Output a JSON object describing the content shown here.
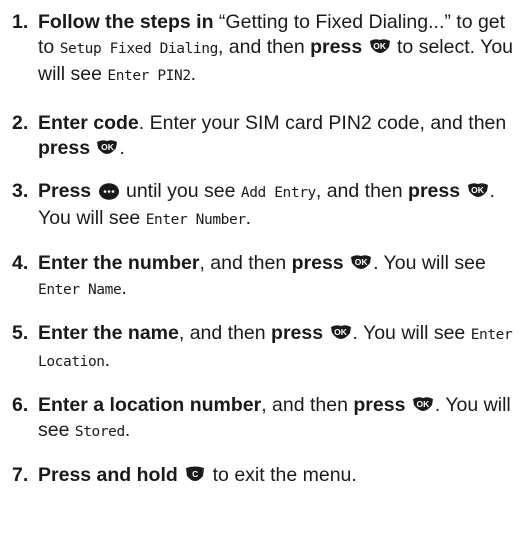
{
  "steps": [
    {
      "number": "1.",
      "parts": [
        {
          "t": "b",
          "v": "Follow the steps in"
        },
        {
          "t": "n",
          "v": " “Getting to Fixed Dialing...” to get to "
        },
        {
          "t": "lcd",
          "v": "Setup Fixed Dialing"
        },
        {
          "t": "n",
          "v": ", and then "
        },
        {
          "t": "b",
          "v": "press"
        },
        {
          "t": "n",
          "v": " "
        },
        {
          "t": "key",
          "v": "OK",
          "icon": "ok-key-icon"
        },
        {
          "t": "n",
          "v": " to select. You will see "
        },
        {
          "t": "lcd",
          "v": "Enter PIN2"
        },
        {
          "t": "n",
          "v": "."
        }
      ]
    },
    {
      "number": "2.",
      "parts": [
        {
          "t": "b",
          "v": "Enter code"
        },
        {
          "t": "n",
          "v": ". Enter your SIM card PIN2 code, and then "
        },
        {
          "t": "b",
          "v": "press"
        },
        {
          "t": "n",
          "v": " "
        },
        {
          "t": "key",
          "v": "OK",
          "icon": "ok-key-icon"
        },
        {
          "t": "n",
          "v": "."
        }
      ]
    },
    {
      "number": "3.",
      "parts": [
        {
          "t": "b",
          "v": "Press"
        },
        {
          "t": "n",
          "v": " "
        },
        {
          "t": "key",
          "v": "",
          "icon": "navigation-key-icon"
        },
        {
          "t": "n",
          "v": " until you see "
        },
        {
          "t": "lcd",
          "v": "Add Entry"
        },
        {
          "t": "n",
          "v": ", and then "
        },
        {
          "t": "b",
          "v": "press"
        },
        {
          "t": "n",
          "v": " "
        },
        {
          "t": "key",
          "v": "OK",
          "icon": "ok-key-icon"
        },
        {
          "t": "n",
          "v": ". You will see "
        },
        {
          "t": "lcd",
          "v": "Enter Number"
        },
        {
          "t": "n",
          "v": "."
        }
      ]
    },
    {
      "number": "4.",
      "parts": [
        {
          "t": "b",
          "v": "Enter the number"
        },
        {
          "t": "n",
          "v": ", and then "
        },
        {
          "t": "b",
          "v": "press"
        },
        {
          "t": "n",
          "v": " "
        },
        {
          "t": "key",
          "v": "OK",
          "icon": "ok-key-icon"
        },
        {
          "t": "n",
          "v": ". You will see "
        },
        {
          "t": "lcd",
          "v": "Enter Name"
        },
        {
          "t": "n",
          "v": "."
        }
      ]
    },
    {
      "number": "5.",
      "parts": [
        {
          "t": "b",
          "v": "Enter the name"
        },
        {
          "t": "n",
          "v": ", and then "
        },
        {
          "t": "b",
          "v": "press"
        },
        {
          "t": "n",
          "v": " "
        },
        {
          "t": "key",
          "v": "OK",
          "icon": "ok-key-icon"
        },
        {
          "t": "n",
          "v": ". You will see "
        },
        {
          "t": "lcd",
          "v": "Enter Location"
        },
        {
          "t": "n",
          "v": "."
        }
      ]
    },
    {
      "number": "6.",
      "parts": [
        {
          "t": "b",
          "v": "Enter a location number"
        },
        {
          "t": "n",
          "v": ", and then "
        },
        {
          "t": "b",
          "v": "press"
        },
        {
          "t": "n",
          "v": " "
        },
        {
          "t": "key",
          "v": "OK",
          "icon": "ok-key-icon"
        },
        {
          "t": "n",
          "v": ". You will see "
        },
        {
          "t": "lcd",
          "v": "Stored"
        },
        {
          "t": "n",
          "v": "."
        }
      ]
    },
    {
      "number": "7.",
      "parts": [
        {
          "t": "b",
          "v": "Press and hold"
        },
        {
          "t": "n",
          "v": " "
        },
        {
          "t": "key",
          "v": "C",
          "icon": "clear-key-icon"
        },
        {
          "t": "n",
          "v": " to exit the menu."
        }
      ]
    }
  ]
}
